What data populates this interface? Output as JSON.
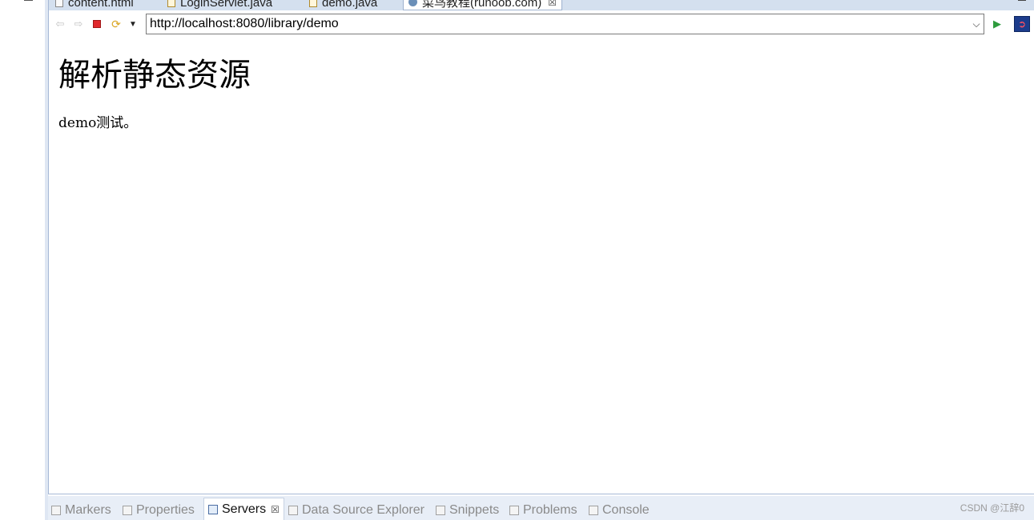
{
  "editor_tabs": [
    {
      "label": "content.html",
      "icon": "html-file-icon"
    },
    {
      "label": "LoginServlet.java",
      "icon": "java-file-icon"
    },
    {
      "label": "demo.java",
      "icon": "java-file-icon"
    },
    {
      "label": "菜鸟教程(runoob.com)",
      "icon": "globe-icon",
      "active": true,
      "close": "☒"
    }
  ],
  "browser": {
    "url": "http://localhost:8080/library/demo",
    "nav_icons": [
      "back-arrow-icon",
      "forward-arrow-icon",
      "stop-icon",
      "refresh-icon",
      "dropdown-arrow-icon"
    ],
    "go_icon": "play-icon"
  },
  "page": {
    "heading": "解析静态资源",
    "paragraph": "demo测试。"
  },
  "bottom_views": [
    {
      "label": "Markers",
      "icon": "markers-icon"
    },
    {
      "label": "Properties",
      "icon": "properties-icon"
    },
    {
      "label": "Servers",
      "icon": "servers-icon",
      "active": true,
      "close": "☒"
    },
    {
      "label": "Data Source Explorer",
      "icon": "data-source-icon"
    },
    {
      "label": "Snippets",
      "icon": "snippets-icon"
    },
    {
      "label": "Problems",
      "icon": "problems-icon"
    },
    {
      "label": "Console",
      "icon": "console-icon"
    }
  ],
  "watermark": "CSDN @江辞0",
  "colors": {
    "tabbar_bg": "#d4e0ef",
    "stop_red": "#e0282c",
    "go_green": "#2e9b3d",
    "bottom_bg": "#e8eef7"
  }
}
